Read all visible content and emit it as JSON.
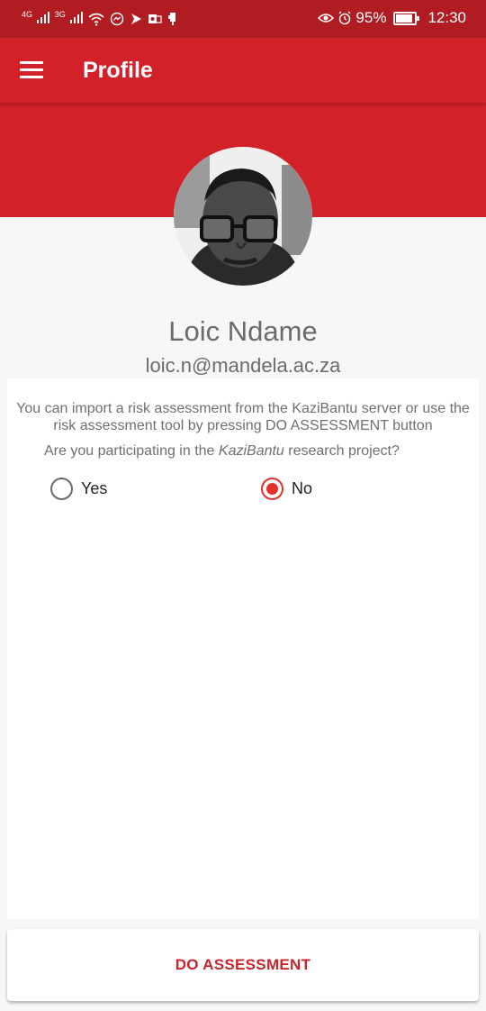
{
  "statusbar": {
    "net1": "4G",
    "net2": "3G",
    "battery_percent": "95%",
    "battery_level": 0.95,
    "time": "12:30",
    "icons": [
      "signal-icon",
      "signal-icon",
      "wifi-icon",
      "messenger-icon",
      "send-icon",
      "outlook-icon",
      "usb-icon",
      "eye-icon",
      "alarm-icon",
      "battery-icon"
    ]
  },
  "appbar": {
    "title": "Profile",
    "menu_icon": "menu-icon"
  },
  "profile": {
    "avatar_icon": "user-photo",
    "name": "Loic Ndame",
    "email": "loic.n@mandela.ac.za"
  },
  "card": {
    "info": "You can import a risk assessment from the KaziBantu server or use the risk assessment tool by pressing DO ASSESSMENT button",
    "question_pre": "Are you participating in the ",
    "question_em": "KaziBantu",
    "question_post": " research project?",
    "options": [
      {
        "label": "Yes",
        "selected": false
      },
      {
        "label": "No",
        "selected": true
      }
    ],
    "accent": "#e0322c"
  },
  "action": {
    "label": "DO ASSESSMENT",
    "color": "#c8242b"
  },
  "colors": {
    "primary": "#d3212a",
    "status_bar": "#b01c22"
  }
}
